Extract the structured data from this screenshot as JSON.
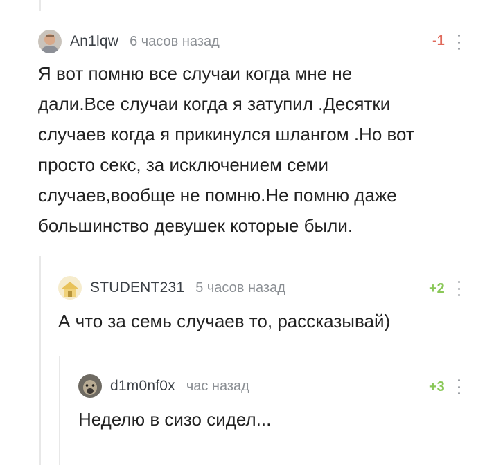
{
  "comments": [
    {
      "author": "An1lqw",
      "time": "6 часов назад",
      "rating": "-1",
      "avatar_icon": "man-photo-avatar",
      "text": "Я вот помню все случаи когда мне не\nдали.Все случаи когда я затупил .Десятки\nслучаев когда я прикинулся шлангом .Но вот\nпросто секс, за исключением семи\nслучаев,вообще не помню.Не помню даже\nбольшинство девушек которые были."
    },
    {
      "author": "STUDENT231",
      "time": "5 часов назад",
      "rating": "+2",
      "avatar_icon": "yellow-house-avatar",
      "text": "А что за семь случаев то, рассказывай)"
    },
    {
      "author": "d1m0nf0x",
      "time": "час назад",
      "rating": "+3",
      "avatar_icon": "dog-photo-avatar",
      "text": "Неделю в сизо сидел..."
    }
  ],
  "colors": {
    "negative_rating": "#e06a5b",
    "positive_rating": "#8ac858",
    "thread_line": "#e8e8e8",
    "meta_text": "#8b8f94"
  }
}
